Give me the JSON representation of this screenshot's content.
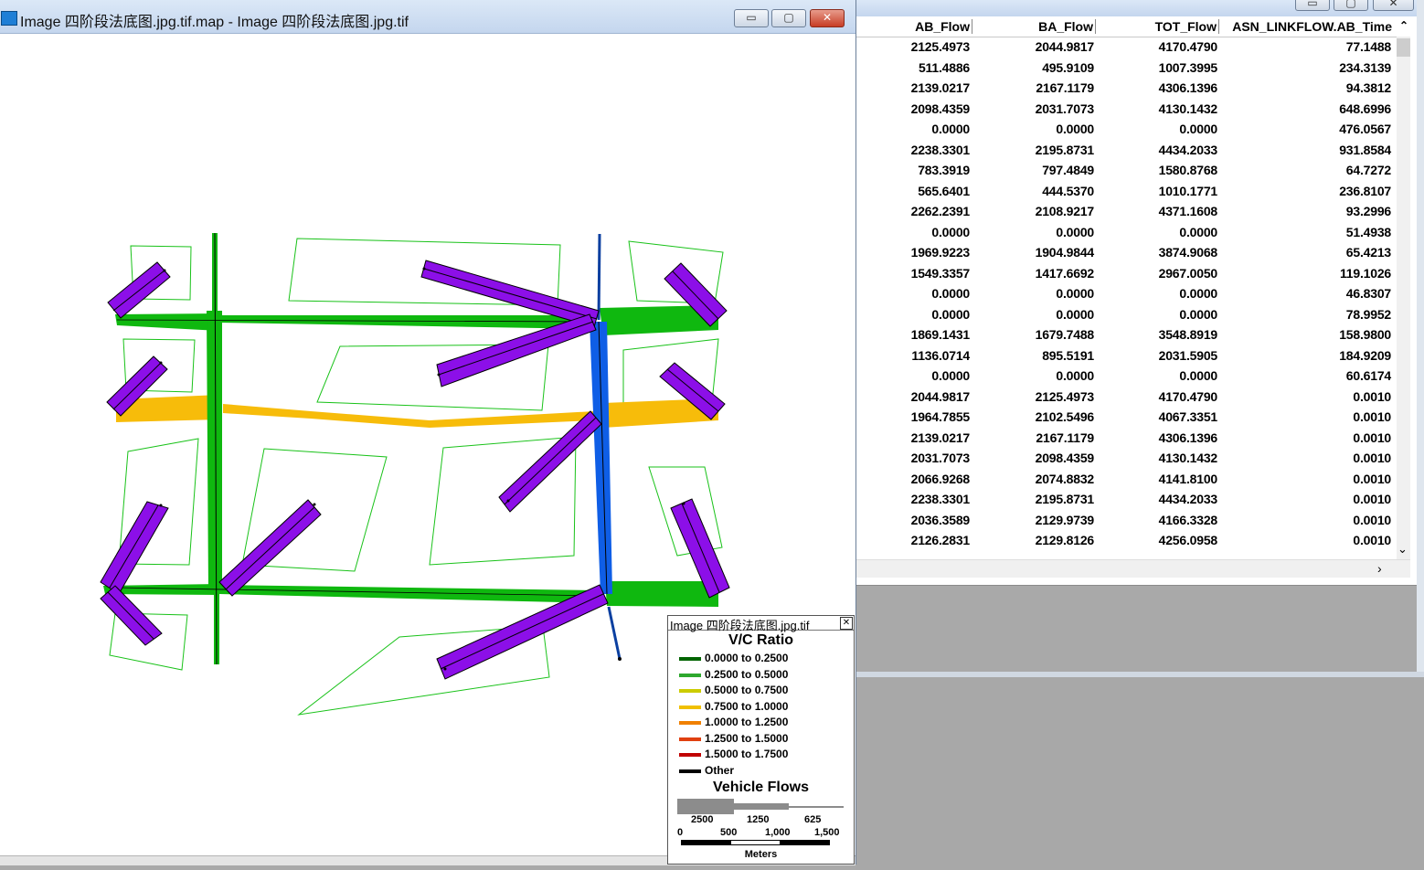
{
  "map_window": {
    "title": "Image 四阶段法底图.jpg.tif.map - Image 四阶段法底图.jpg.tif",
    "buttons": {
      "minimize": "▭",
      "maximize": "▢",
      "close": "✕"
    }
  },
  "data_window": {
    "buttons": {
      "minimize": "▭",
      "maximize": "▢",
      "close": "✕"
    },
    "columns": [
      "AB_Flow",
      "BA_Flow",
      "TOT_Flow",
      "ASN_LINKFLOW.AB_Time"
    ],
    "rows": [
      [
        "2125.4973",
        "2044.9817",
        "4170.4790",
        "77.1488"
      ],
      [
        "511.4886",
        "495.9109",
        "1007.3995",
        "234.3139"
      ],
      [
        "2139.0217",
        "2167.1179",
        "4306.1396",
        "94.3812"
      ],
      [
        "2098.4359",
        "2031.7073",
        "4130.1432",
        "648.6996"
      ],
      [
        "0.0000",
        "0.0000",
        "0.0000",
        "476.0567"
      ],
      [
        "2238.3301",
        "2195.8731",
        "4434.2033",
        "931.8584"
      ],
      [
        "783.3919",
        "797.4849",
        "1580.8768",
        "64.7272"
      ],
      [
        "565.6401",
        "444.5370",
        "1010.1771",
        "236.8107"
      ],
      [
        "2262.2391",
        "2108.9217",
        "4371.1608",
        "93.2996"
      ],
      [
        "0.0000",
        "0.0000",
        "0.0000",
        "51.4938"
      ],
      [
        "1969.9223",
        "1904.9844",
        "3874.9068",
        "65.4213"
      ],
      [
        "1549.3357",
        "1417.6692",
        "2967.0050",
        "119.1026"
      ],
      [
        "0.0000",
        "0.0000",
        "0.0000",
        "46.8307"
      ],
      [
        "0.0000",
        "0.0000",
        "0.0000",
        "78.9952"
      ],
      [
        "1869.1431",
        "1679.7488",
        "3548.8919",
        "158.9800"
      ],
      [
        "1136.0714",
        "895.5191",
        "2031.5905",
        "184.9209"
      ],
      [
        "0.0000",
        "0.0000",
        "0.0000",
        "60.6174"
      ],
      [
        "2044.9817",
        "2125.4973",
        "4170.4790",
        "0.0010"
      ],
      [
        "1964.7855",
        "2102.5496",
        "4067.3351",
        "0.0010"
      ],
      [
        "2139.0217",
        "2167.1179",
        "4306.1396",
        "0.0010"
      ],
      [
        "2031.7073",
        "2098.4359",
        "4130.1432",
        "0.0010"
      ],
      [
        "2066.9268",
        "2074.8832",
        "4141.8100",
        "0.0010"
      ],
      [
        "2238.3301",
        "2195.8731",
        "4434.2033",
        "0.0010"
      ],
      [
        "2036.3589",
        "2129.9739",
        "4166.3328",
        "0.0010"
      ],
      [
        "2126.2831",
        "2129.8126",
        "4256.0958",
        "0.0010"
      ]
    ]
  },
  "legend": {
    "window_title": "Image 四阶段法底图.jpg.tif",
    "vc_title": "V/C Ratio",
    "vc_items": [
      {
        "label": "0.0000 to 0.2500",
        "color": "#006400"
      },
      {
        "label": "0.2500 to 0.5000",
        "color": "#2ea82e"
      },
      {
        "label": "0.5000 to 0.7500",
        "color": "#cccc00"
      },
      {
        "label": "0.7500 to 1.0000",
        "color": "#f0c000"
      },
      {
        "label": "1.0000 to 1.2500",
        "color": "#f08000"
      },
      {
        "label": "1.2500 to 1.5000",
        "color": "#e04010"
      },
      {
        "label": "1.5000 to 1.7500",
        "color": "#c00000"
      },
      {
        "label": "Other",
        "color": "#000000"
      }
    ],
    "flows_title": "Vehicle Flows",
    "flow_values": [
      "2500",
      "1250",
      "625"
    ],
    "scale_values": [
      "0",
      "500",
      "1,000",
      "1,500"
    ],
    "scale_unit": "Meters"
  },
  "colors": {
    "green": "#0fb80f",
    "yellow": "#f7bc0a",
    "purple": "#8c0fe8",
    "blue": "#0f5ee6",
    "zone": "#19c219"
  }
}
